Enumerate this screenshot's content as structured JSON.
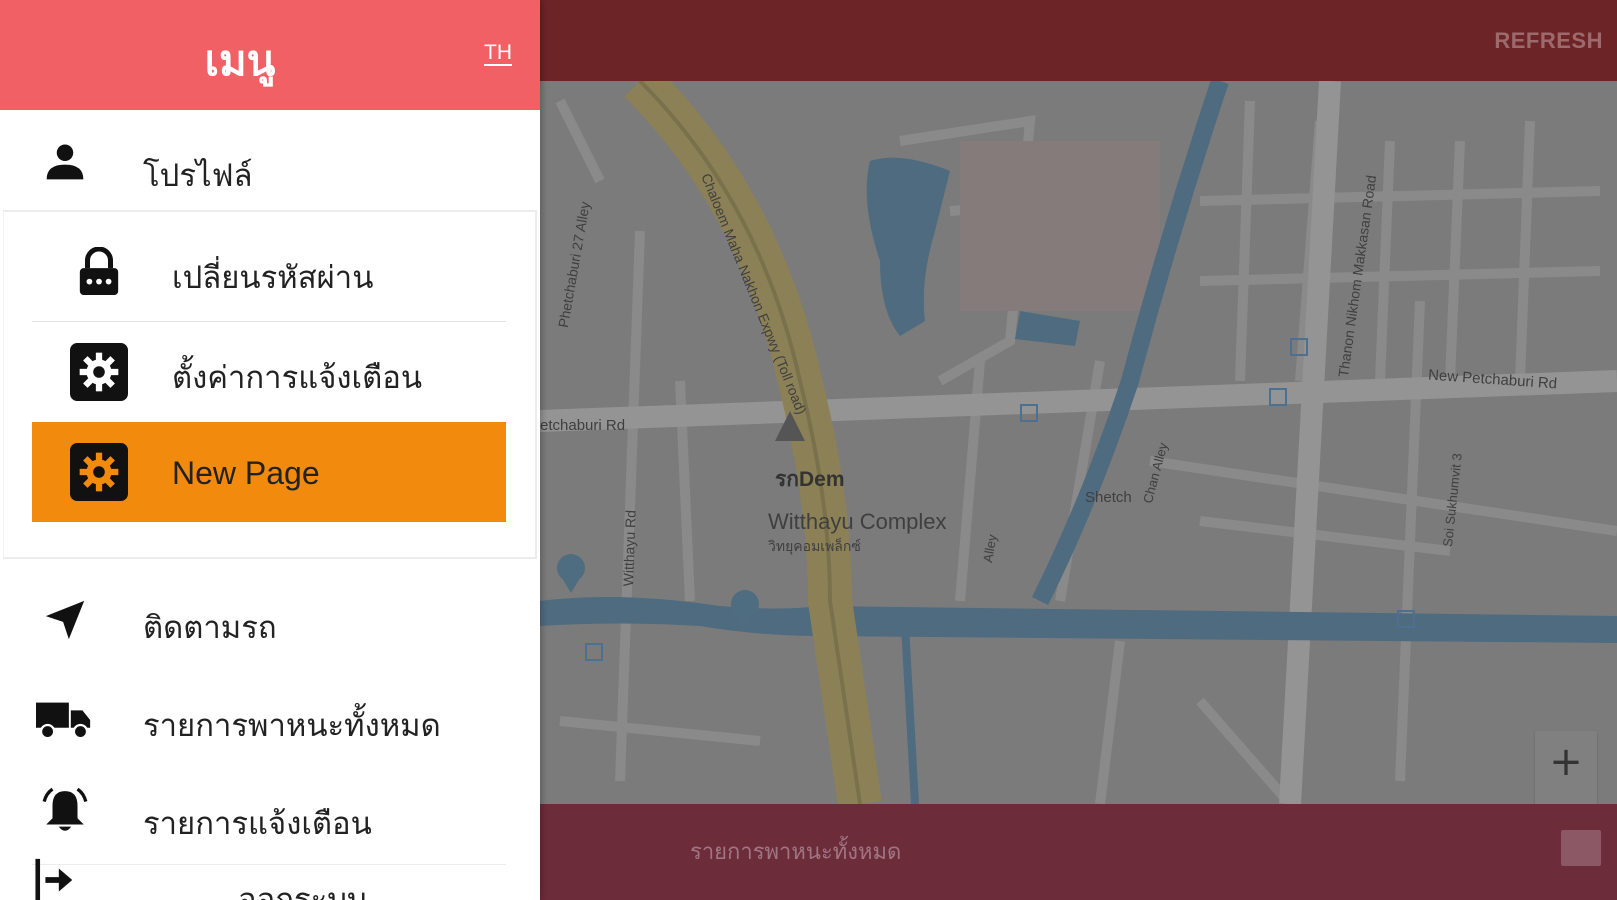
{
  "app": {
    "refresh_label": "REFRESH",
    "bottom_label": "รายการพาหนะทั้งหมด",
    "zoom_in_label": "+",
    "zoom_out_label": "−"
  },
  "map": {
    "labels": {
      "place_witthayu": "Witthayu Complex",
      "place_witthayu_th": "วิทยุคอมเพล็กซ์",
      "place_srinDerm": "รกDem",
      "road_expressway": "Chaloem Maha Nakhon Expwy (Toll road)",
      "road_petchaburi_left": "etchaburi Rd",
      "road_petchaburi_right": "New Petchaburi Rd",
      "road_petchaburi_alley": "Phetchaburi 27 Alley",
      "road_witthayu": "Witthayu Rd",
      "road_makkasan": "Thanon Nikhom Makkasan Road",
      "road_sukhumvit": "Soi Sukhumvit 3",
      "road_alley1": "Alley",
      "road_alley2": "Chan Alley",
      "road_shetch": "Shetch"
    },
    "colors": {
      "base": "#7b7b7b",
      "road": "#8d8d8d",
      "water": "#4f6b7f",
      "highway": "#8c8156"
    }
  },
  "drawer": {
    "title": "เมนู",
    "lang_button": "TH",
    "items": {
      "profile": {
        "label": "โปรไฟล์",
        "icon": "person-icon"
      },
      "change_password": {
        "label": "เปลี่ยนรหัสผ่าน",
        "icon": "lock-icon"
      },
      "notification_settings": {
        "label": "ตั้งค่าการแจ้งเตือน",
        "icon": "gear-icon"
      },
      "new_page": {
        "label": "New Page",
        "icon": "gear-icon"
      },
      "track_vehicle": {
        "label": "ติดตามรถ",
        "icon": "navigation-arrow-icon"
      },
      "all_vehicles": {
        "label": "รายการพาหนะทั้งหมด",
        "icon": "truck-icon"
      },
      "notifications": {
        "label": "รายการแจ้งเตือน",
        "icon": "bell-icon"
      },
      "logout": {
        "label": "ออกระบบ",
        "icon": "logout-icon"
      }
    },
    "colors": {
      "header": "#f06064",
      "active": "#f28a0d"
    }
  }
}
